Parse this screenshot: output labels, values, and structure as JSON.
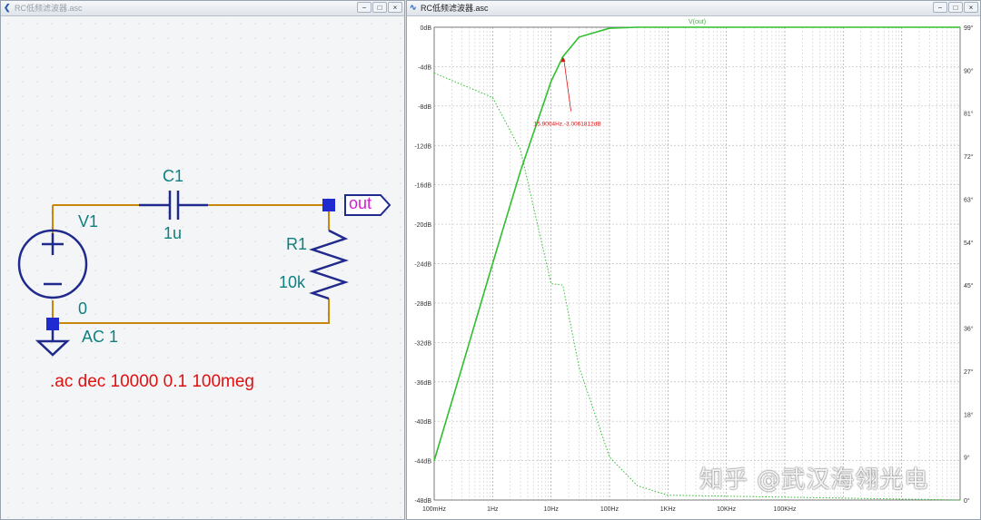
{
  "schematic_window": {
    "title": "RC低频滤波器.asc",
    "buttons": [
      "−",
      "□",
      "×"
    ]
  },
  "plot_window": {
    "title": "RC低频滤波器.asc",
    "buttons": [
      "−",
      "□",
      "×"
    ]
  },
  "schematic": {
    "v1_name": "V1",
    "v1_value": "AC 1",
    "v1_node": "0",
    "c1_name": "C1",
    "c1_value": "1u",
    "r1_name": "R1",
    "r1_value": "10k",
    "out_label": "out",
    "directive": ".ac dec 10000 0.1 100meg",
    "plus": "+",
    "minus": "−"
  },
  "cursor_annotation": "15.9004Hz,-3.0061812dB",
  "watermark": "知乎 @武汉海翎光电",
  "colors": {
    "wire": "#c8860c",
    "component": "#1f2a8c",
    "label": "#0f7f7f",
    "directive": "#e01010",
    "trace": "#2fbf2f",
    "annotation": "#e01010"
  },
  "chart_data": {
    "type": "line",
    "title": "V(out)",
    "x_ticks": [
      "100mHz",
      "1Hz",
      "10Hz",
      "100Hz",
      "1KHz",
      "10KHz",
      "100KHz"
    ],
    "xlim": [
      0.1,
      100000000
    ],
    "x_scale": "log",
    "y_left_ticks": [
      "0dB",
      "-4dB",
      "-8dB",
      "-12dB",
      "-16dB",
      "-20dB",
      "-24dB",
      "-28dB",
      "-32dB",
      "-36dB",
      "-40dB",
      "-44dB",
      "-48dB"
    ],
    "ylim_left": [
      -48,
      0
    ],
    "y_right_ticks": [
      "99°",
      "90°",
      "81°",
      "72°",
      "63°",
      "54°",
      "45°",
      "36°",
      "27°",
      "18°",
      "9°",
      "0°"
    ],
    "ylim_right": [
      0,
      99
    ],
    "grid": true,
    "series": [
      {
        "name": "V(out)",
        "axis": "left",
        "style": "solid",
        "x": [
          0.1,
          0.3,
          1,
          3,
          10,
          15.9,
          30,
          100,
          300,
          1000,
          100000000
        ],
        "y": [
          -44.0,
          -34.5,
          -24.0,
          -14.6,
          -5.5,
          -3.0,
          -1.0,
          -0.1,
          0,
          0,
          0
        ]
      },
      {
        "axis": "right",
        "style": "dotted",
        "x": [
          0.1,
          1,
          3,
          10,
          15.9,
          30,
          100,
          300,
          1000,
          100000000
        ],
        "y": [
          89.4,
          84.3,
          73.3,
          45.3,
          45.0,
          27.9,
          9.0,
          3.0,
          1.0,
          0
        ]
      }
    ]
  }
}
